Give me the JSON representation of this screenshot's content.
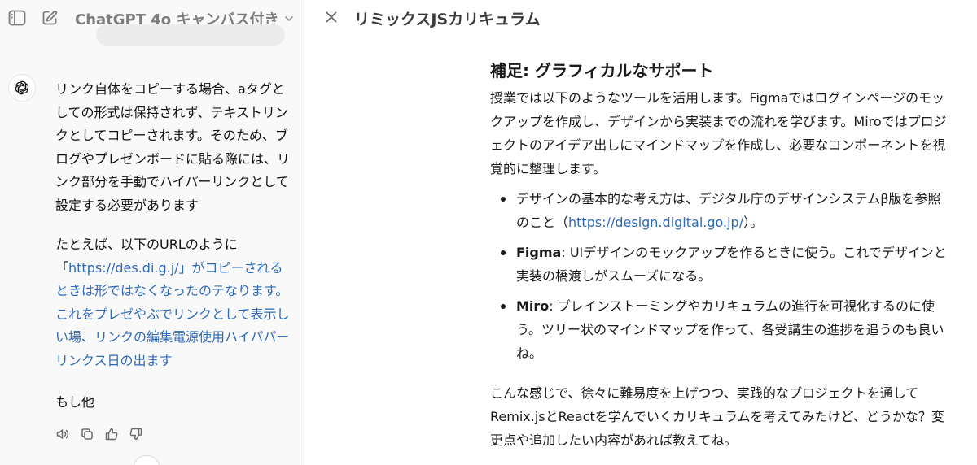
{
  "header": {
    "model_title": "ChatGPT 4o キャンバス付き"
  },
  "chat": {
    "paragraph1": "リンク自体をコピーする場合、aタグとしての形式は保持されず、テキストリンクとしてコピーされます。そのため、ブログやプレゼンボードに貼る際には、リンク部分を手動でハイパーリンクとして設定する必要があります",
    "paragraph2_prefix": "たとえば、以下のURLのように「",
    "paragraph2_link": "https://des.di.g.j/」がコピーされるときは形ではなくなったのテなります。これをプレゼやぶでリンクとして表示しい場、リンクの編集電源使用ハイパパーリンクス日の出ます",
    "paragraph3": "もし他"
  },
  "canvas": {
    "title": "リミックスJSカリキュラム",
    "heading": "補足: グラフィカルなサポート",
    "intro": "授業では以下のようなツールを活用します。Figmaではログインページのモックアップを作成し、デザインから実装までの流れを学びます。Miroではプロジェクトのアイデア出しにマインドマップを作成し、必要なコンポーネントを視覚的に整理します。",
    "bullets": [
      {
        "text": "デザインの基本的な考え方は、デジタル庁のデザインシステムβ版を参照のこと（",
        "link": "https://design.digital.go.jp/",
        "suffix": "）。"
      },
      {
        "bold": "Figma",
        "text": ": UIデザインのモックアップを作るときに使う。これでデザインと実装の橋渡しがスムーズになる。"
      },
      {
        "bold": "Miro",
        "text": ": ブレインストーミングやカリキュラムの進行を可視化するのに使う。ツリー状のマインドマップを作って、各受講生の進捗を追うのも良いね。"
      }
    ],
    "closing": "こんな感じで、徐々に難易度を上げつつ、実践的なプロジェクトを通してRemix.jsとReactを学んでいくカリキュラムを考えてみたけど、どうかな？変更点や追加したい内容があれば教えてね。"
  },
  "colors": {
    "link": "#2e6ab8",
    "sidebar_bg": "#f9f9f9",
    "muted_text": "#7d7d7d"
  }
}
